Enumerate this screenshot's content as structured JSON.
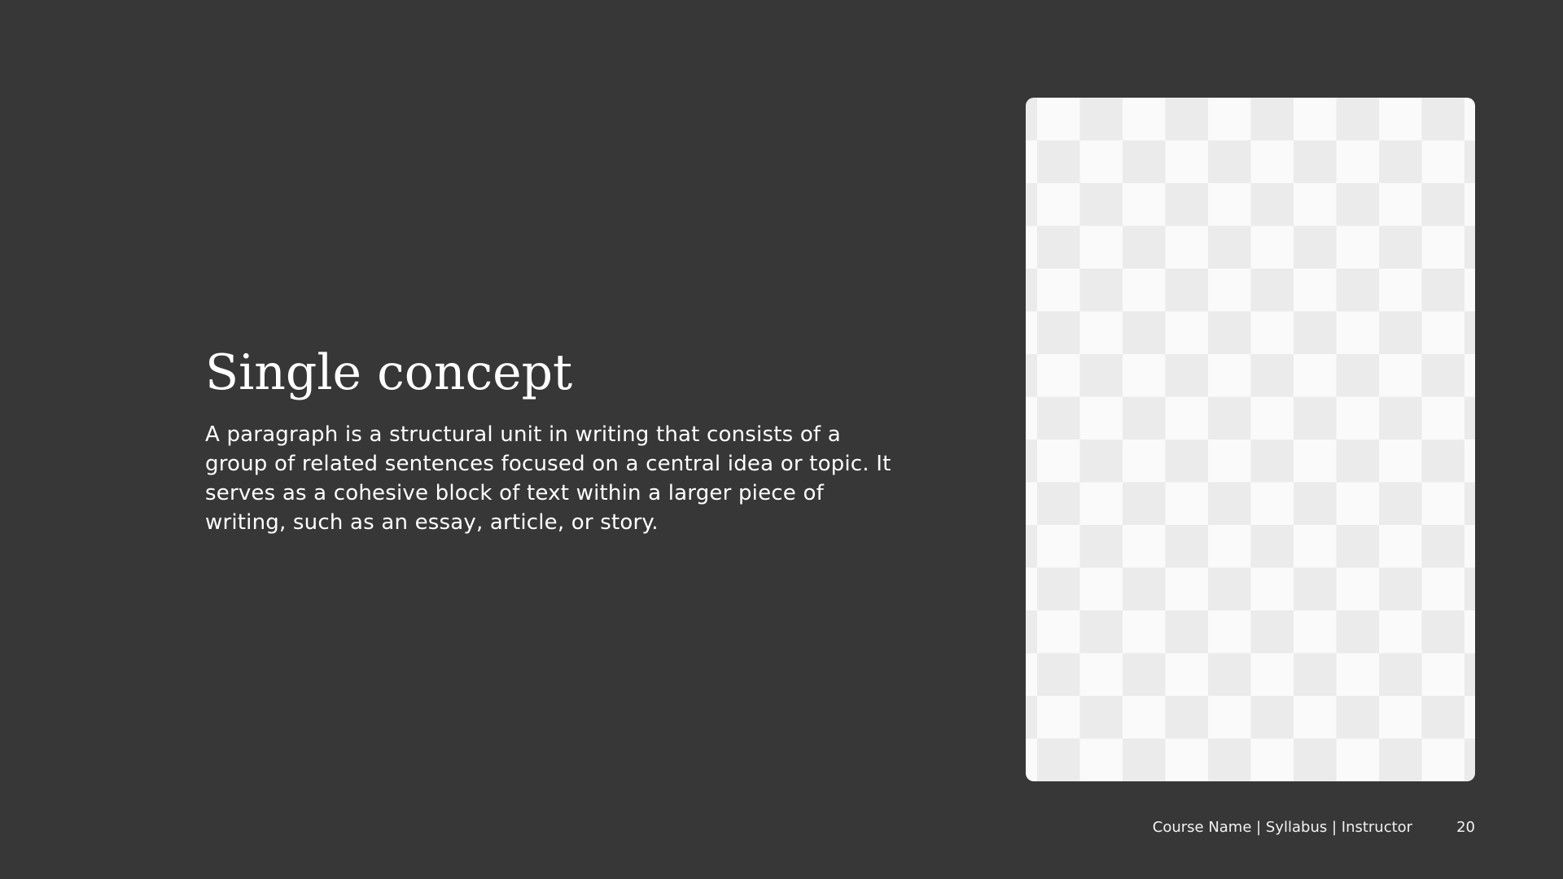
{
  "colors": {
    "background": "#373737",
    "text": "#ffffff",
    "footer_text": "#f2f2f2"
  },
  "slide": {
    "title": "Single concept",
    "body": "A paragraph is a structural unit in writing that consists of a group of related sentences focused on a central idea or topic. It serves as a cohesive block of text within a larger piece of writing, such as an essay, article, or story."
  },
  "footer": {
    "course_info": "Course Name | Syllabus | Instructor",
    "page_number": "20"
  }
}
